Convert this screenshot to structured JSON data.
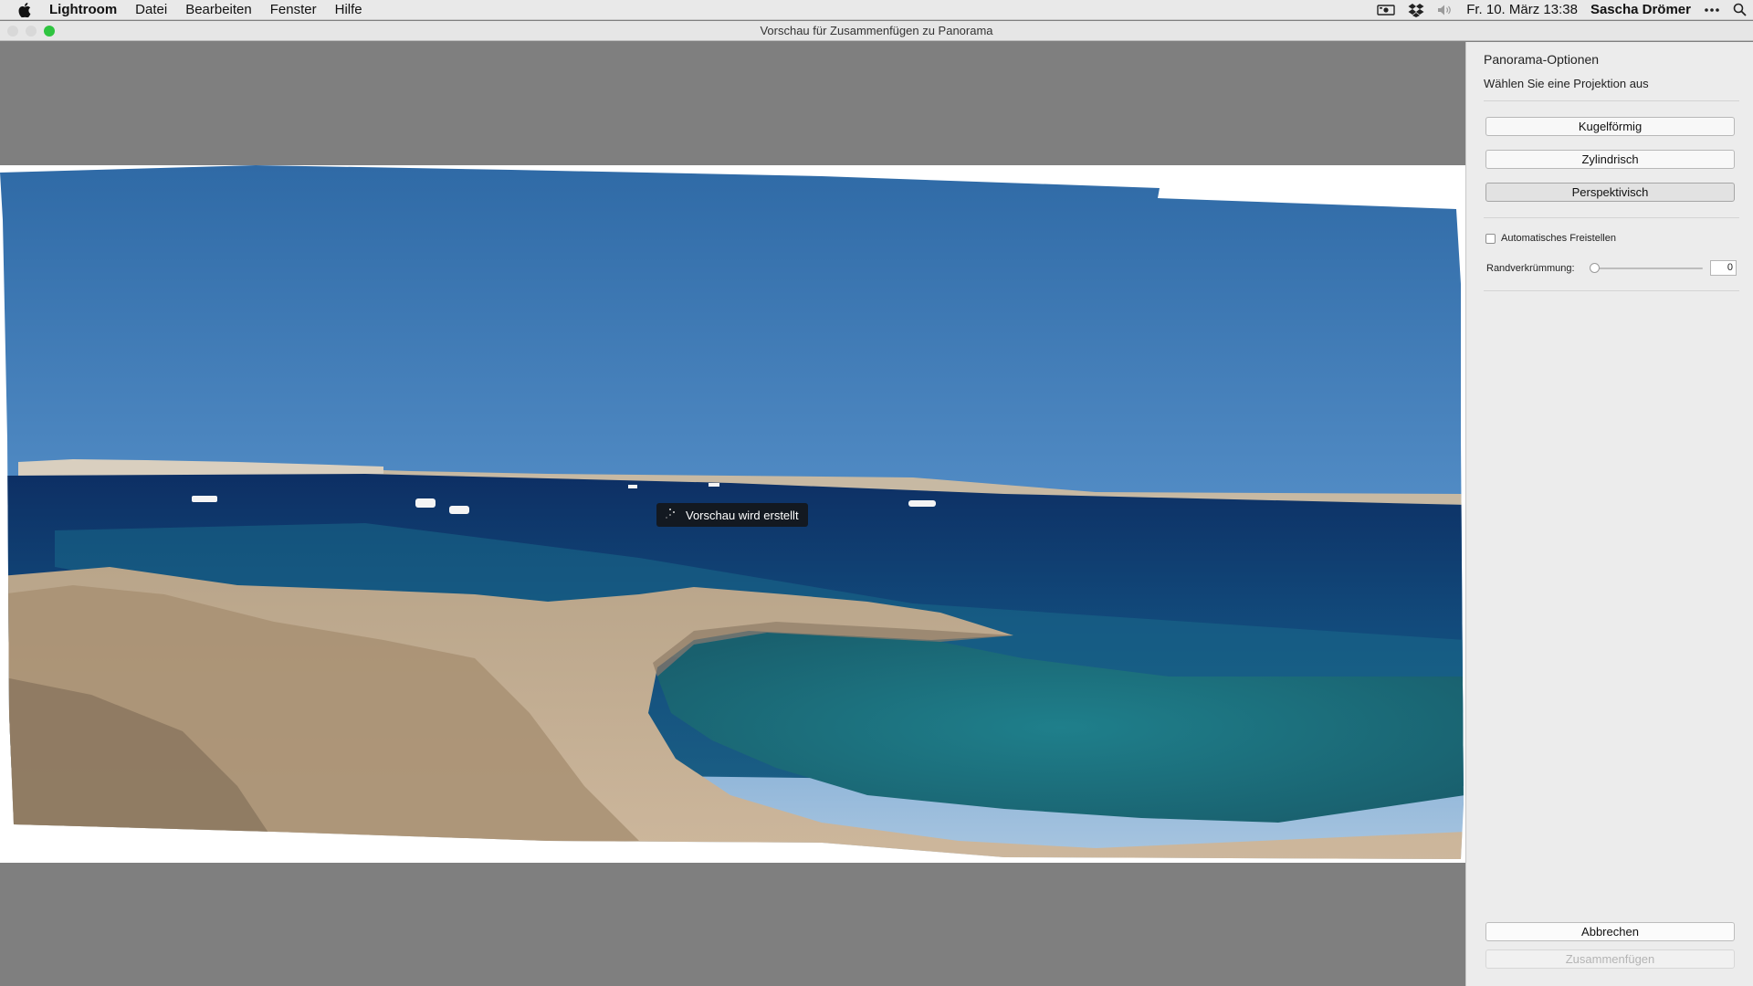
{
  "menubar": {
    "apple_icon": "apple-icon",
    "app_name": "Lightroom",
    "items": [
      "Datei",
      "Bearbeiten",
      "Fenster",
      "Hilfe"
    ],
    "status_icons": [
      "screen-capture-icon",
      "dropbox-icon",
      "volume-icon"
    ],
    "clock": "Fr. 10. März  13:38",
    "user": "Sascha Drömer",
    "more_icon": "more-icon",
    "spotlight_icon": "search-icon"
  },
  "window": {
    "title": "Vorschau für Zusammenfügen zu Panorama",
    "traffic_colors": {
      "close": "#d8d8d8",
      "minimize": "#d8d8d8",
      "zoom": "#2fc440"
    }
  },
  "preview": {
    "status_text": "Vorschau wird erstellt"
  },
  "panel": {
    "heading": "Panorama-Optionen",
    "subheading": "Wählen Sie eine Projektion aus",
    "projections": [
      {
        "label": "Kugelförmig",
        "active": false
      },
      {
        "label": "Zylindrisch",
        "active": false
      },
      {
        "label": "Perspektivisch",
        "active": true
      }
    ],
    "auto_crop": {
      "label": "Automatisches Freistellen",
      "checked": false
    },
    "boundary_warp": {
      "label": "Randverkrümmung:",
      "value": "0"
    },
    "cancel_label": "Abbrechen",
    "merge_label": "Zusammenfügen"
  }
}
